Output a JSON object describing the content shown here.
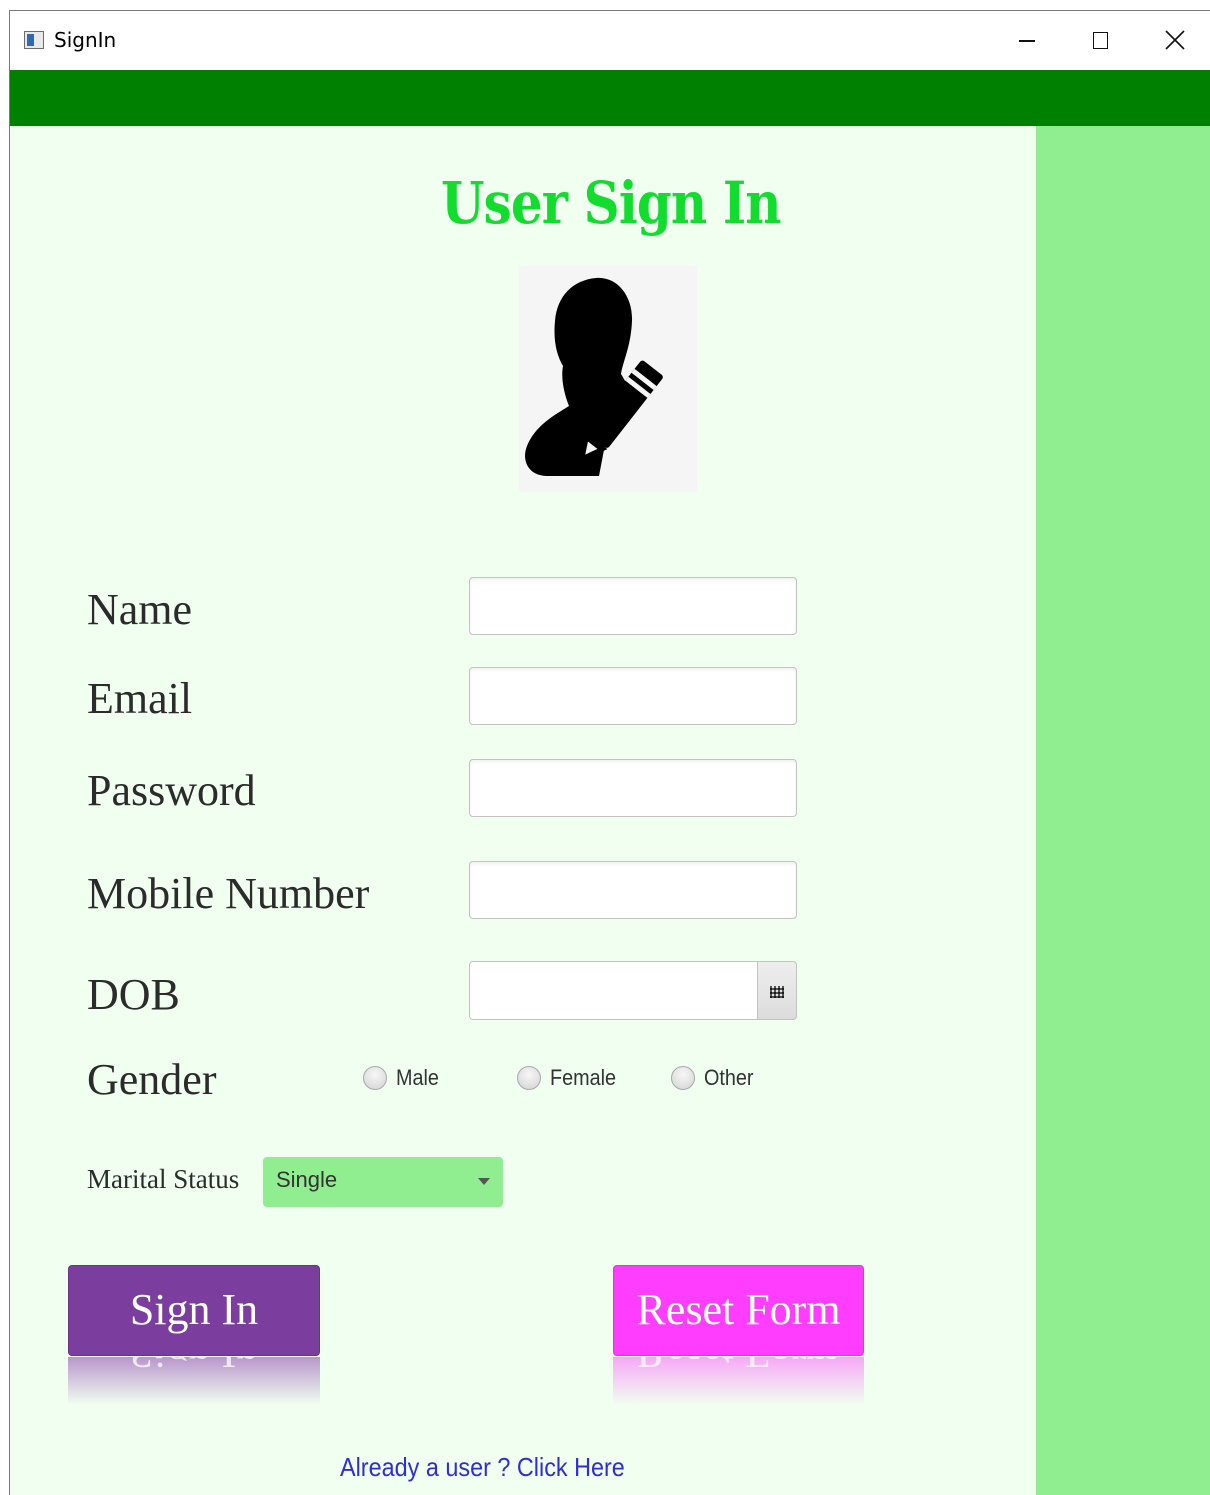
{
  "window": {
    "title": "SignIn",
    "controls": {
      "minimize": "minimize-icon",
      "maximize": "maximize-icon",
      "close": "close-icon"
    }
  },
  "colors": {
    "header_bar": "#008000",
    "content_bg": "#f0fff0",
    "side_panel": "#90ee90",
    "title": "#12dd2f",
    "sign_in_button": "#7c3e9e",
    "reset_button": "#ff3dff",
    "link": "#2e2ed6"
  },
  "page": {
    "title": "User Sign In",
    "avatar_icon": "user-edit-icon"
  },
  "form": {
    "name_label": "Name",
    "name_value": "",
    "email_label": "Email",
    "email_value": "",
    "password_label": "Password",
    "password_value": "",
    "mobile_label": "Mobile Number",
    "mobile_value": "",
    "dob_label": "DOB",
    "dob_value": "",
    "dob_icon": "calendar-icon",
    "gender_label": "Gender",
    "gender_options": [
      "Male",
      "Female",
      "Other"
    ],
    "gender_selected": null,
    "marital_label": "Marital Status",
    "marital_value": "Single"
  },
  "buttons": {
    "sign_in": "Sign In",
    "reset": "Reset Form"
  },
  "link": {
    "already_user": "Already a user ? Click Here"
  }
}
